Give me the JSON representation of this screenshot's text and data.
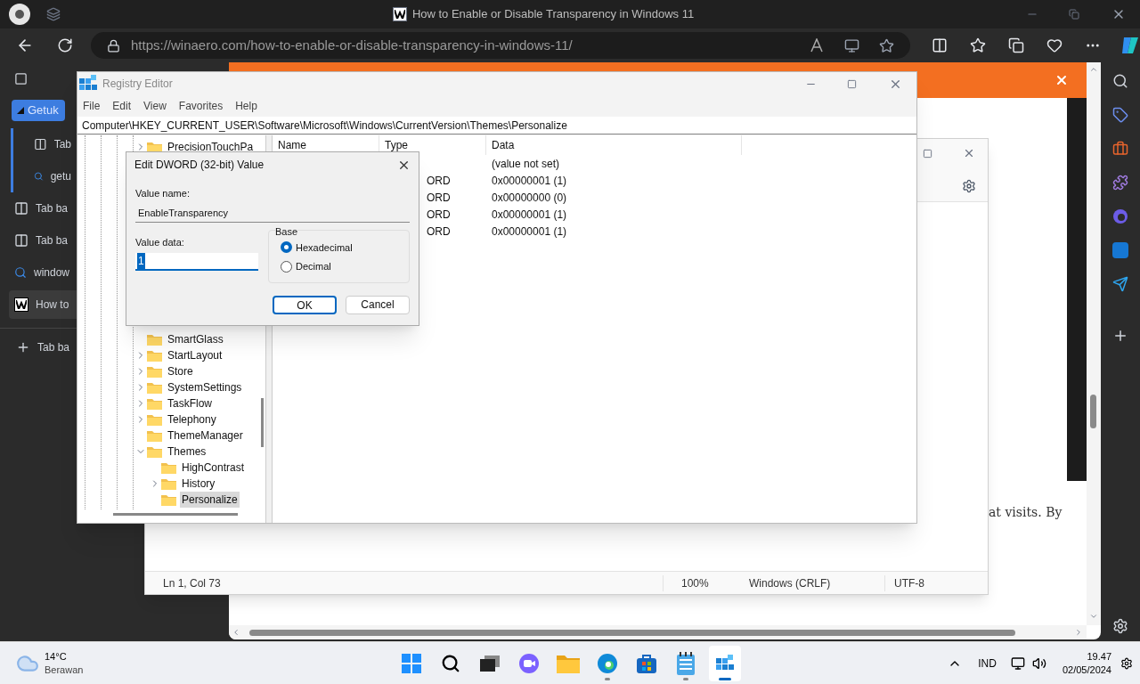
{
  "browser": {
    "title": "How to Enable or Disable Transparency in Windows 11",
    "url_host": "https://winaero.com",
    "url_path": "/how-to-enable-or-disable-transparency-in-windows-11/"
  },
  "tab_group": {
    "label": "Getuk"
  },
  "tabs": [
    {
      "kind": "page",
      "label": "Tab",
      "selected": false,
      "grouped": true
    },
    {
      "kind": "search",
      "label": "getu",
      "selected": false,
      "grouped": true
    },
    {
      "kind": "page",
      "label": "Tab ba",
      "selected": false,
      "grouped": false
    },
    {
      "kind": "page",
      "label": "Tab ba",
      "selected": false,
      "grouped": false
    },
    {
      "kind": "search",
      "label": "window",
      "selected": false,
      "grouped": false
    },
    {
      "kind": "site",
      "label": "How to",
      "selected": true,
      "grouped": false
    }
  ],
  "new_tab": {
    "label": "Tab ba"
  },
  "web_page": {
    "text": "at visits. By"
  },
  "notepad": {
    "status": [
      "Ln 1, Col 73",
      "100%",
      "Windows (CRLF)",
      "UTF-8"
    ]
  },
  "registry": {
    "title": "Registry Editor",
    "menu": [
      "File",
      "Edit",
      "View",
      "Favorites",
      "Help"
    ],
    "address": "Computer\\HKEY_CURRENT_USER\\Software\\Microsoft\\Windows\\CurrentVersion\\Themes\\Personalize",
    "tree_top": [
      {
        "label": "PrecisionTouchPa",
        "kind": "collapsed",
        "selected": false
      }
    ],
    "tree": [
      {
        "label": "SmartGlass",
        "kind": "leaf",
        "selected": false
      },
      {
        "label": "StartLayout",
        "kind": "collapsed",
        "selected": false
      },
      {
        "label": "Store",
        "kind": "collapsed",
        "selected": false
      },
      {
        "label": "SystemSettings",
        "kind": "collapsed",
        "selected": false
      },
      {
        "label": "TaskFlow",
        "kind": "collapsed",
        "selected": false
      },
      {
        "label": "Telephony",
        "kind": "collapsed",
        "selected": false
      },
      {
        "label": "ThemeManager",
        "kind": "leaf",
        "selected": false
      },
      {
        "label": "Themes",
        "kind": "expanded",
        "selected": false,
        "children": [
          {
            "label": "HighContrast",
            "kind": "leaf",
            "selected": false
          },
          {
            "label": "History",
            "kind": "collapsed",
            "selected": false
          },
          {
            "label": "Personalize",
            "kind": "leaf",
            "selected": true
          }
        ]
      }
    ],
    "columns": [
      "Name",
      "Type",
      "Data"
    ],
    "rows": [
      {
        "data": "(value not set)"
      },
      {
        "type": "ORD",
        "data": "0x00000001 (1)"
      },
      {
        "type": "ORD",
        "data": "0x00000000 (0)"
      },
      {
        "type": "ORD",
        "data": "0x00000001 (1)"
      },
      {
        "type": "ORD",
        "data": "0x00000001 (1)"
      }
    ]
  },
  "dialog": {
    "title": "Edit DWORD (32-bit) Value",
    "value_name_label": "Value name:",
    "value_name": "EnableTransparency",
    "value_data_label": "Value data:",
    "value_data": "1",
    "base_label": "Base",
    "radios": [
      {
        "label": "Hexadecimal",
        "selected": true
      },
      {
        "label": "Decimal",
        "selected": false
      }
    ],
    "buttons": [
      {
        "label": "OK",
        "default": true
      },
      {
        "label": "Cancel",
        "default": false
      }
    ]
  },
  "taskbar": {
    "temperature": "14°C",
    "weather": "Berawan",
    "language": "IND",
    "time": "19.47",
    "date": "02/05/2024",
    "apps": [
      {
        "kind": "start",
        "running": false,
        "active": false
      },
      {
        "kind": "search",
        "running": false,
        "active": false
      },
      {
        "kind": "taskview",
        "running": false,
        "active": false
      },
      {
        "kind": "chat",
        "running": false,
        "active": false
      },
      {
        "kind": "explorer",
        "running": false,
        "active": false
      },
      {
        "kind": "edge",
        "running": true,
        "active": false
      },
      {
        "kind": "store",
        "running": false,
        "active": false
      },
      {
        "kind": "notepad",
        "running": true,
        "active": false
      },
      {
        "kind": "regedit",
        "running": true,
        "active": true
      }
    ]
  }
}
